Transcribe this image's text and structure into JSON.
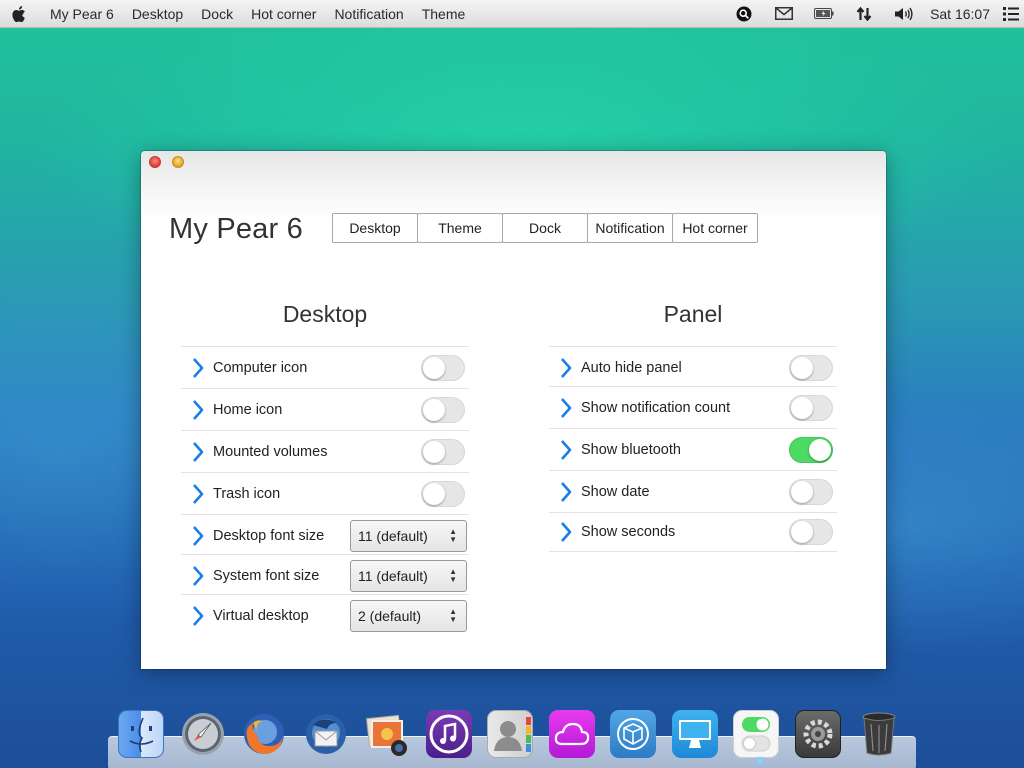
{
  "menubar": {
    "app_name": "My Pear 6",
    "menus": [
      "Desktop",
      "Dock",
      "Hot corner",
      "Notification",
      "Theme"
    ],
    "tray_icons": [
      "search-icon",
      "mail-icon",
      "battery-icon",
      "network-icon",
      "volume-icon",
      "list-icon"
    ],
    "clock": "Sat 16:07"
  },
  "window": {
    "title": "My Pear 6",
    "tabs": [
      "Desktop",
      "Theme",
      "Dock",
      "Notification",
      "Hot corner"
    ],
    "desktop_section": {
      "title": "Desktop",
      "toggles": [
        {
          "label": "Computer icon",
          "on": false
        },
        {
          "label": "Home icon",
          "on": false
        },
        {
          "label": "Mounted volumes",
          "on": false
        },
        {
          "label": "Trash icon",
          "on": false
        }
      ],
      "selects": [
        {
          "label": "Desktop font size",
          "value": "11 (default)"
        },
        {
          "label": "System font size",
          "value": "11 (default)"
        },
        {
          "label": "Virtual desktop",
          "value": "2 (default)"
        }
      ]
    },
    "panel_section": {
      "title": "Panel",
      "toggles": [
        {
          "label": "Auto hide panel",
          "on": false
        },
        {
          "label": "Show notification count",
          "on": false
        },
        {
          "label": "Show bluetooth",
          "on": true
        },
        {
          "label": "Show date",
          "on": false
        },
        {
          "label": "Show seconds",
          "on": false
        }
      ]
    }
  },
  "dock": {
    "items": [
      "finder-icon",
      "launchpad-icon",
      "firefox-icon",
      "thunderbird-icon",
      "photos-icon",
      "itunes-icon",
      "contacts-icon",
      "icloud-icon",
      "software-center-icon",
      "screen-icon",
      "settings-toggle-icon",
      "system-preferences-icon",
      "trash-icon"
    ]
  },
  "colors": {
    "toggle_on": "#4cd964",
    "chevron": "#1a7ee6",
    "accent_blue": "#2a7cc0"
  }
}
